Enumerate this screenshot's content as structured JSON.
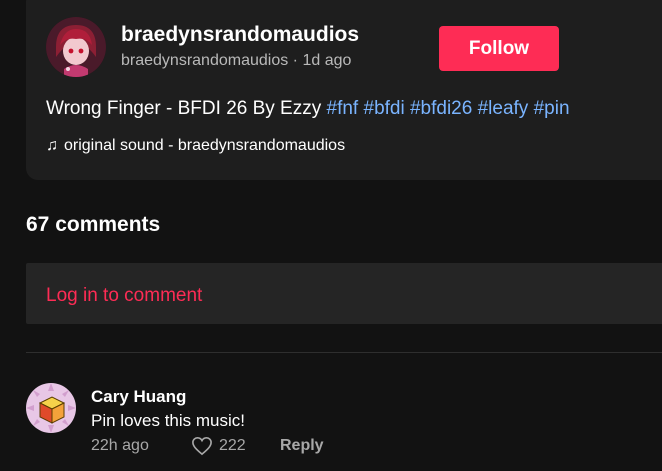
{
  "post": {
    "username": "braedynsrandomaudios",
    "handle": "braedynsrandomaudios",
    "separator": "·",
    "time_ago": "1d ago",
    "follow_label": "Follow",
    "description_text": "Wrong Finger - BFDI 26 By Ezzy",
    "hashtags": [
      "#fnf",
      "#bfdi",
      "#bfdi26",
      "#leafy",
      "#pin"
    ],
    "sound_icon": "music-note-icon",
    "sound_label": "original sound - braedynsrandomaudios"
  },
  "comments": {
    "count_label": "67 comments",
    "login_label": "Log in to comment",
    "items": [
      {
        "author": "Cary Huang",
        "text": "Pin loves this music!",
        "time": "22h ago",
        "likes": "222",
        "reply_label": "Reply",
        "like_icon": "heart-outline-icon"
      }
    ]
  },
  "colors": {
    "background": "#121212",
    "card": "#1e1e1e",
    "accent": "#fe2c55",
    "hashtag": "#7ab4ff",
    "muted": "#a8a8a8"
  }
}
